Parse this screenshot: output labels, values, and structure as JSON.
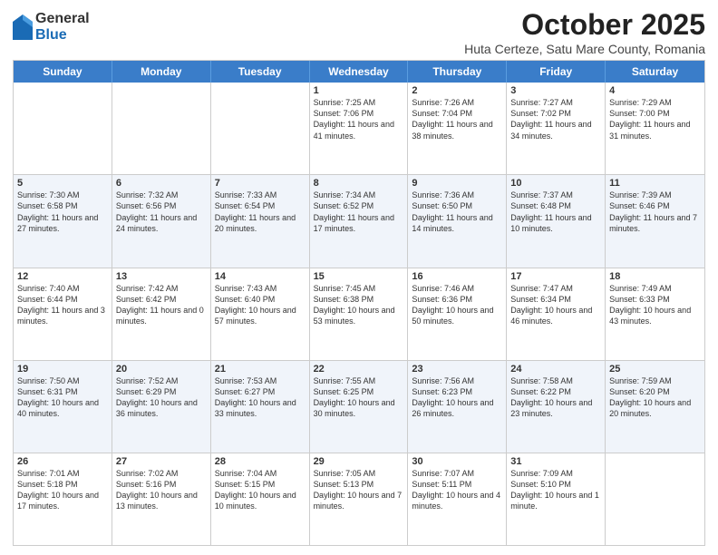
{
  "logo": {
    "general": "General",
    "blue": "Blue"
  },
  "title": "October 2025",
  "location": "Huta Certeze, Satu Mare County, Romania",
  "days_header": [
    "Sunday",
    "Monday",
    "Tuesday",
    "Wednesday",
    "Thursday",
    "Friday",
    "Saturday"
  ],
  "rows": [
    {
      "alt": false,
      "cells": [
        {
          "num": "",
          "info": ""
        },
        {
          "num": "",
          "info": ""
        },
        {
          "num": "",
          "info": ""
        },
        {
          "num": "1",
          "info": "Sunrise: 7:25 AM\nSunset: 7:06 PM\nDaylight: 11 hours and 41 minutes."
        },
        {
          "num": "2",
          "info": "Sunrise: 7:26 AM\nSunset: 7:04 PM\nDaylight: 11 hours and 38 minutes."
        },
        {
          "num": "3",
          "info": "Sunrise: 7:27 AM\nSunset: 7:02 PM\nDaylight: 11 hours and 34 minutes."
        },
        {
          "num": "4",
          "info": "Sunrise: 7:29 AM\nSunset: 7:00 PM\nDaylight: 11 hours and 31 minutes."
        }
      ]
    },
    {
      "alt": true,
      "cells": [
        {
          "num": "5",
          "info": "Sunrise: 7:30 AM\nSunset: 6:58 PM\nDaylight: 11 hours and 27 minutes."
        },
        {
          "num": "6",
          "info": "Sunrise: 7:32 AM\nSunset: 6:56 PM\nDaylight: 11 hours and 24 minutes."
        },
        {
          "num": "7",
          "info": "Sunrise: 7:33 AM\nSunset: 6:54 PM\nDaylight: 11 hours and 20 minutes."
        },
        {
          "num": "8",
          "info": "Sunrise: 7:34 AM\nSunset: 6:52 PM\nDaylight: 11 hours and 17 minutes."
        },
        {
          "num": "9",
          "info": "Sunrise: 7:36 AM\nSunset: 6:50 PM\nDaylight: 11 hours and 14 minutes."
        },
        {
          "num": "10",
          "info": "Sunrise: 7:37 AM\nSunset: 6:48 PM\nDaylight: 11 hours and 10 minutes."
        },
        {
          "num": "11",
          "info": "Sunrise: 7:39 AM\nSunset: 6:46 PM\nDaylight: 11 hours and 7 minutes."
        }
      ]
    },
    {
      "alt": false,
      "cells": [
        {
          "num": "12",
          "info": "Sunrise: 7:40 AM\nSunset: 6:44 PM\nDaylight: 11 hours and 3 minutes."
        },
        {
          "num": "13",
          "info": "Sunrise: 7:42 AM\nSunset: 6:42 PM\nDaylight: 11 hours and 0 minutes."
        },
        {
          "num": "14",
          "info": "Sunrise: 7:43 AM\nSunset: 6:40 PM\nDaylight: 10 hours and 57 minutes."
        },
        {
          "num": "15",
          "info": "Sunrise: 7:45 AM\nSunset: 6:38 PM\nDaylight: 10 hours and 53 minutes."
        },
        {
          "num": "16",
          "info": "Sunrise: 7:46 AM\nSunset: 6:36 PM\nDaylight: 10 hours and 50 minutes."
        },
        {
          "num": "17",
          "info": "Sunrise: 7:47 AM\nSunset: 6:34 PM\nDaylight: 10 hours and 46 minutes."
        },
        {
          "num": "18",
          "info": "Sunrise: 7:49 AM\nSunset: 6:33 PM\nDaylight: 10 hours and 43 minutes."
        }
      ]
    },
    {
      "alt": true,
      "cells": [
        {
          "num": "19",
          "info": "Sunrise: 7:50 AM\nSunset: 6:31 PM\nDaylight: 10 hours and 40 minutes."
        },
        {
          "num": "20",
          "info": "Sunrise: 7:52 AM\nSunset: 6:29 PM\nDaylight: 10 hours and 36 minutes."
        },
        {
          "num": "21",
          "info": "Sunrise: 7:53 AM\nSunset: 6:27 PM\nDaylight: 10 hours and 33 minutes."
        },
        {
          "num": "22",
          "info": "Sunrise: 7:55 AM\nSunset: 6:25 PM\nDaylight: 10 hours and 30 minutes."
        },
        {
          "num": "23",
          "info": "Sunrise: 7:56 AM\nSunset: 6:23 PM\nDaylight: 10 hours and 26 minutes."
        },
        {
          "num": "24",
          "info": "Sunrise: 7:58 AM\nSunset: 6:22 PM\nDaylight: 10 hours and 23 minutes."
        },
        {
          "num": "25",
          "info": "Sunrise: 7:59 AM\nSunset: 6:20 PM\nDaylight: 10 hours and 20 minutes."
        }
      ]
    },
    {
      "alt": false,
      "cells": [
        {
          "num": "26",
          "info": "Sunrise: 7:01 AM\nSunset: 5:18 PM\nDaylight: 10 hours and 17 minutes."
        },
        {
          "num": "27",
          "info": "Sunrise: 7:02 AM\nSunset: 5:16 PM\nDaylight: 10 hours and 13 minutes."
        },
        {
          "num": "28",
          "info": "Sunrise: 7:04 AM\nSunset: 5:15 PM\nDaylight: 10 hours and 10 minutes."
        },
        {
          "num": "29",
          "info": "Sunrise: 7:05 AM\nSunset: 5:13 PM\nDaylight: 10 hours and 7 minutes."
        },
        {
          "num": "30",
          "info": "Sunrise: 7:07 AM\nSunset: 5:11 PM\nDaylight: 10 hours and 4 minutes."
        },
        {
          "num": "31",
          "info": "Sunrise: 7:09 AM\nSunset: 5:10 PM\nDaylight: 10 hours and 1 minute."
        },
        {
          "num": "",
          "info": ""
        }
      ]
    }
  ]
}
